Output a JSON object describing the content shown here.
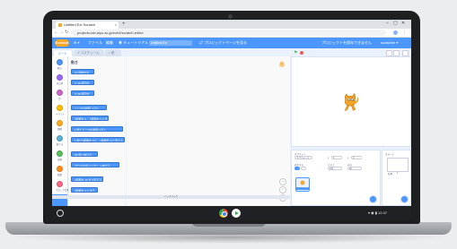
{
  "browser": {
    "tab_title": "Untitled Ext Scratch",
    "url": "projects-lab.aiyu.ac.jp/ext/#/scratch-editor",
    "new_tab": "+",
    "close": "×",
    "back": "←",
    "forward": "→",
    "reload": "↻",
    "menu": "⋮",
    "min": "–",
    "max": "▢",
    "close_win": "✕"
  },
  "scratch": {
    "logo": "Scratch",
    "menu_items": [
      "⊕ ▾",
      "ファイル",
      "編集",
      "◉ チュートリアル"
    ],
    "project_title": "Untitled-Ext",
    "share_label": "⇄ プロジェクトページを見る",
    "save_label": "プロジェクトを保存できません",
    "account_label": "scratcher ▾",
    "tabs": {
      "code": "コード",
      "costumes": "✐ コスチューム",
      "sounds": "♪ 音"
    },
    "categories": [
      {
        "label": "動き",
        "color": "#4c97ff"
      },
      {
        "label": "見た目",
        "color": "#9966ff"
      },
      {
        "label": "音",
        "color": "#cf63cf"
      },
      {
        "label": "イベント",
        "color": "#ffbf00"
      },
      {
        "label": "制御",
        "color": "#ffab19"
      },
      {
        "label": "調べる",
        "color": "#5cb1d6"
      },
      {
        "label": "演算",
        "color": "#59c059"
      },
      {
        "label": "変数",
        "color": "#ff8c1a"
      },
      {
        "label": "ブロック定義",
        "color": "#ff6680"
      }
    ],
    "palette_heading": "動き",
    "blocks": [
      "10 歩動かす",
      "↻ 15 度回す",
      "↺ 15 度回す",
      "どこかの場所 へ行く",
      "x座標を 0 、y座標を 0 にする",
      "1 秒でどこかの場所へ行く",
      "1 秒でx座標を 0 に、y座標を 0 に変える",
      "90 度に向ける",
      "マウスのポインター へ向ける",
      "x座標を 10 ずつ変える",
      "x座標を 0 にする"
    ],
    "backpack": "バックパック",
    "sprite": {
      "sprite_label": "スプライト",
      "sprite_name": "スプライト1",
      "x_label": "x",
      "x_value": "0",
      "y_label": "y",
      "y_value": "0",
      "show_label": "表示する",
      "size_label": "大きさ",
      "size_value": "100",
      "direction_label": "向き",
      "direction_value": "90",
      "thumb_label": "スプライト1"
    },
    "stage_label": "ステージ",
    "backdrops_label": "背景",
    "backdrops_count": "1"
  },
  "shelf": {
    "tray": "▾ ◉ ▮ 12:47"
  },
  "colors": {
    "scratch_blue": "#4c97ff",
    "shelf": "#202124"
  }
}
